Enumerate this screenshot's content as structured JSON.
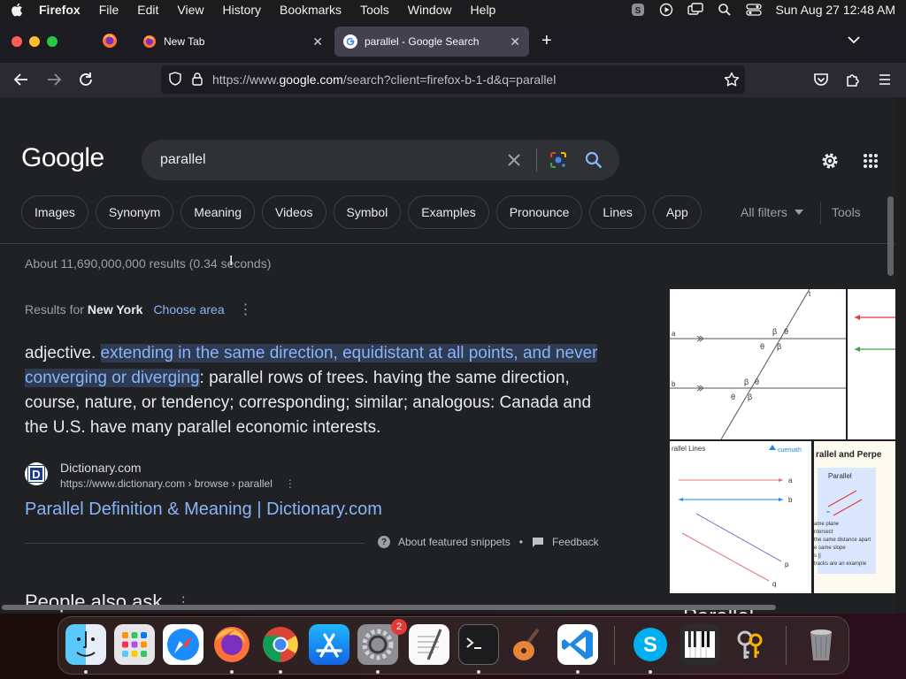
{
  "menubar": {
    "items": [
      "Firefox",
      "File",
      "Edit",
      "View",
      "History",
      "Bookmarks",
      "Tools",
      "Window",
      "Help"
    ],
    "clock": "Sun Aug 27  12:48 AM"
  },
  "tabs": [
    {
      "title": "New Tab"
    },
    {
      "title": "parallel - Google Search"
    }
  ],
  "urlbar": {
    "prefix": "https://www.",
    "domain": "google.com",
    "rest": "/search?client=firefox-b-1-d&q=parallel"
  },
  "search": {
    "logo": "Google",
    "query": "parallel"
  },
  "chips": [
    "Images",
    "Synonym",
    "Meaning",
    "Videos",
    "Symbol",
    "Examples",
    "Pronounce",
    "Lines",
    "App"
  ],
  "filters": {
    "all_filters": "All filters",
    "tools": "Tools"
  },
  "stats": "About 11,690,000,000 results (0.34 seconds)",
  "location": {
    "prefix": "Results for",
    "place": "New York",
    "choose": "Choose area"
  },
  "snippet": {
    "lead": "adjective. ",
    "highlight": "extending in the same direction, equidistant at all points, and never converging or diverging",
    "rest": ": parallel rows of trees. having the same direction, course, nature, or tendency; corresponding; similar; analogous: Canada and the U.S. have many parallel economic interests."
  },
  "source": {
    "name": "Dictionary.com",
    "url": "https://www.dictionary.com › browse › parallel",
    "link": "Parallel Definition & Meaning | Dictionary.com",
    "icon_letter": "D"
  },
  "snippet_footer": {
    "about": "About featured snippets",
    "bullet": "•",
    "feedback": "Feedback"
  },
  "people_also_ask": "People also ask",
  "image_panel": {
    "img1_labels": {
      "t": "t",
      "a": "a",
      "b": "b",
      "beta": "β",
      "theta": "θ"
    },
    "img2_title": "rallel Lines",
    "img2_brand": "cuemath",
    "img2_labels": [
      "a",
      "b",
      "p",
      "q"
    ],
    "img3_title": "rallel and Perpe",
    "img3_card_title": "Parallel",
    "img3_notes": [
      "ame plane",
      "ntersect",
      "the same distance apart",
      "e same slope",
      "s ||",
      "tracks are an example"
    ],
    "title": "Parallel"
  },
  "dock": {
    "apps": [
      "finder-icon",
      "launchpad-icon",
      "safari-icon",
      "firefox-icon",
      "chrome-icon",
      "app-store-icon",
      "system-settings-icon",
      "textedit-icon",
      "terminal-icon",
      "garageband-icon",
      "vscode-icon",
      "skype-icon",
      "piano-icon",
      "keychain-icon",
      "trash-icon"
    ],
    "settings_badge": "2"
  },
  "colors": {
    "page_bg": "#202124",
    "link": "#8ab4f8",
    "highlight_bg": "#2e3b52",
    "text": "#e8eaed",
    "muted": "#9aa0a6"
  }
}
